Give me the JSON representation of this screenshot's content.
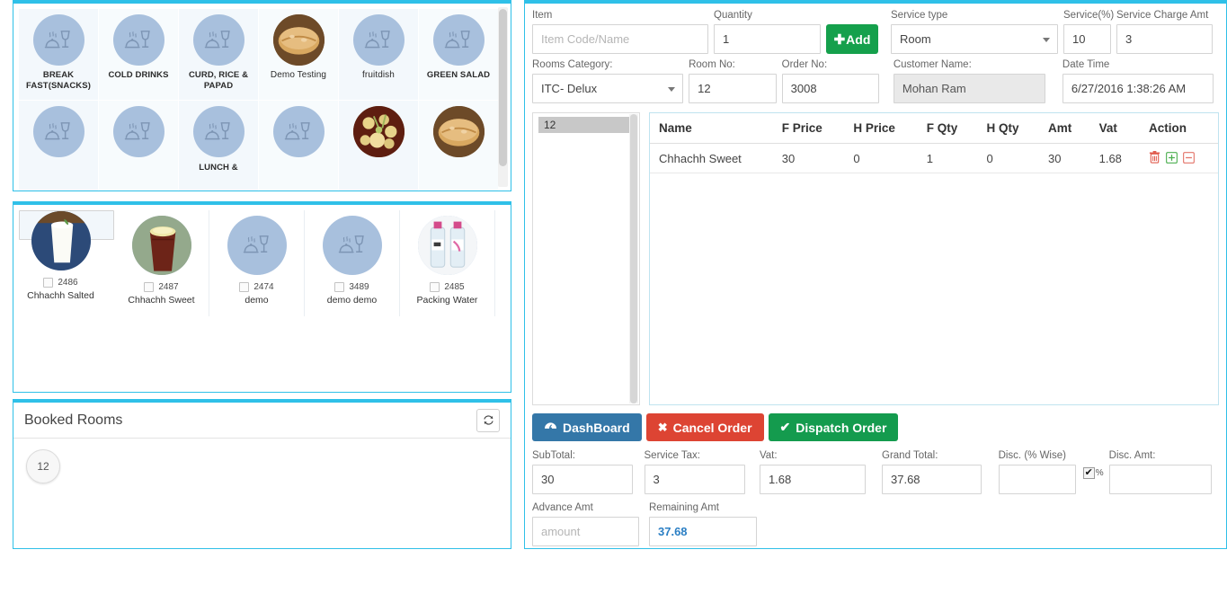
{
  "colors": {
    "panel_border": "#2fc0e8",
    "add_green": "#15a04c",
    "dashboard_blue": "#3477a8",
    "cancel_red": "#dd4433",
    "dispatch_green": "#149b4e",
    "icon_circle": "#a8c0dd",
    "remaining_value": "#2b7fc4"
  },
  "categories": {
    "row1": [
      {
        "label": "BREAK FAST(SNACKS)",
        "icon": "dish-wineglass-icon",
        "has_photo": false
      },
      {
        "label": "COLD DRINKS",
        "icon": "dish-wineglass-icon",
        "has_photo": false
      },
      {
        "label": "CURD, RICE & PAPAD",
        "icon": "dish-wineglass-icon",
        "has_photo": false
      },
      {
        "label": "Demo Testing",
        "icon": "bread-photo",
        "has_photo": true
      },
      {
        "label": "fruitdish",
        "icon": "dish-wineglass-icon",
        "has_photo": false
      },
      {
        "label": "GREEN SALAD",
        "icon": "dish-wineglass-icon",
        "has_photo": false
      }
    ],
    "row2": [
      {
        "label": "",
        "icon": "dish-wineglass-icon",
        "has_photo": false
      },
      {
        "label": "",
        "icon": "dish-wineglass-icon",
        "has_photo": false
      },
      {
        "label": "LUNCH &",
        "icon": "dish-wineglass-icon",
        "has_photo": false
      },
      {
        "label": "",
        "icon": "dish-wineglass-icon",
        "has_photo": false
      },
      {
        "label": "",
        "icon": "salad-photo",
        "has_photo": true
      },
      {
        "label": "",
        "icon": "bread-photo",
        "has_photo": true
      }
    ]
  },
  "items": [
    {
      "code": "2486",
      "name": "Chhachh Salted",
      "icon": "lassi-photo",
      "selected": true,
      "checked": false
    },
    {
      "code": "2487",
      "name": "Chhachh Sweet",
      "icon": "lassi-cup-photo",
      "selected": false,
      "checked": false
    },
    {
      "code": "2474",
      "name": "demo",
      "icon": "dish-wineglass-icon",
      "selected": false,
      "checked": false
    },
    {
      "code": "3489",
      "name": "demo demo",
      "icon": "dish-wineglass-icon",
      "selected": false,
      "checked": false
    },
    {
      "code": "2485",
      "name": "Packing Water",
      "icon": "water-bottles-photo",
      "selected": false,
      "checked": false
    }
  ],
  "booked_rooms": {
    "title": "Booked Rooms",
    "refresh_icon": "refresh-icon",
    "rooms": [
      "12"
    ]
  },
  "form": {
    "item": {
      "label": "Item",
      "value": "",
      "placeholder": "Item Code/Name"
    },
    "quantity": {
      "label": "Quantity",
      "value": "1"
    },
    "add_button": {
      "label": "Add",
      "icon": "plus-icon"
    },
    "service_type": {
      "label": "Service type",
      "value": "Room"
    },
    "service_pct": {
      "label": "Service(%)",
      "value": "10"
    },
    "service_charge_amt": {
      "label": "Service Charge Amt",
      "value": "3"
    },
    "rooms_category": {
      "label": "Rooms Category:",
      "value": "ITC- Delux"
    },
    "room_no": {
      "label": "Room No:",
      "value": "12"
    },
    "order_no": {
      "label": "Order No:",
      "value": "3008"
    },
    "customer_name": {
      "label": "Customer Name:",
      "value": "Mohan Ram"
    },
    "date_time": {
      "label": "Date Time",
      "value": "6/27/2016 1:38:26 AM"
    }
  },
  "room_list": {
    "options": [
      "12"
    ],
    "selected": "12"
  },
  "order_table": {
    "columns": [
      "Name",
      "F Price",
      "H Price",
      "F Qty",
      "H Qty",
      "Amt",
      "Vat",
      "Action"
    ],
    "rows": [
      {
        "name": "Chhachh Sweet",
        "f_price": "30",
        "h_price": "0",
        "f_qty": "1",
        "h_qty": "0",
        "amt": "30",
        "vat": "1.68",
        "actions": [
          "trash-icon",
          "plus-box-icon",
          "minus-box-icon"
        ]
      }
    ]
  },
  "buttons": {
    "dashboard": {
      "label": "DashBoard",
      "icon": "dashboard-icon"
    },
    "cancel_order": {
      "label": "Cancel Order",
      "icon": "x-icon"
    },
    "dispatch_order": {
      "label": "Dispatch Order",
      "icon": "check-icon"
    }
  },
  "totals": {
    "subtotal": {
      "label": "SubTotal:",
      "value": "30"
    },
    "service_tax": {
      "label": "Service Tax:",
      "value": "3"
    },
    "vat": {
      "label": "Vat:",
      "value": "1.68"
    },
    "grand_total": {
      "label": "Grand Total:",
      "value": "37.68"
    },
    "disc_pct": {
      "label": "Disc. (% Wise)",
      "value": ""
    },
    "pct_toggle": {
      "label": "%",
      "checked": true
    },
    "disc_amt": {
      "label": "Disc. Amt:",
      "value": ""
    },
    "advance_amt": {
      "label": "Advance Amt",
      "value": "",
      "placeholder": "amount"
    },
    "remaining_amt": {
      "label": "Remaining Amt",
      "value": "37.68"
    }
  }
}
